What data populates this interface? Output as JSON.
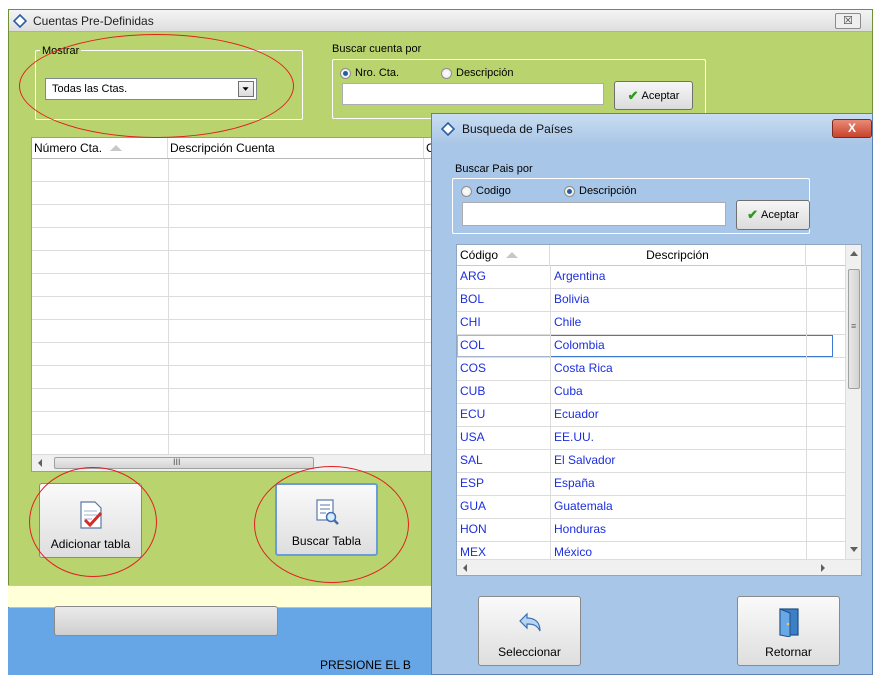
{
  "main_window": {
    "title": "Cuentas Pre-Definidas",
    "close_glyph": "☒",
    "mostrar": {
      "label": "Mostrar",
      "selected": "Todas las Ctas."
    },
    "buscar_cuenta": {
      "label": "Buscar cuenta por",
      "options": [
        "Nro. Cta.",
        "Descripción"
      ],
      "selected_index": 0,
      "value": "",
      "accept_label": "Aceptar"
    },
    "grid": {
      "columns": [
        "Número Cta.",
        "Descripción Cuenta",
        "C"
      ],
      "scroll_glyph": "III"
    },
    "buttons": {
      "adicionar": "Adicionar tabla",
      "buscar": "Buscar Tabla"
    },
    "footer_text": "PRESIONE EL B"
  },
  "dialog": {
    "title": "Busqueda de Países",
    "close_glyph": "X",
    "search": {
      "label": "Buscar Pais por",
      "options": [
        "Codigo",
        "Descripción"
      ],
      "selected_index": 1,
      "value": "",
      "accept_label": "Aceptar"
    },
    "grid": {
      "columns": [
        "Código",
        "Descripción"
      ],
      "selected_row": 3,
      "rows": [
        {
          "code": "ARG",
          "desc": "Argentina"
        },
        {
          "code": "BOL",
          "desc": "Bolivia"
        },
        {
          "code": "CHI",
          "desc": "Chile"
        },
        {
          "code": "COL",
          "desc": "Colombia"
        },
        {
          "code": "COS",
          "desc": "Costa Rica"
        },
        {
          "code": "CUB",
          "desc": "Cuba"
        },
        {
          "code": "ECU",
          "desc": "Ecuador"
        },
        {
          "code": "USA",
          "desc": "EE.UU."
        },
        {
          "code": "SAL",
          "desc": "El Salvador"
        },
        {
          "code": "ESP",
          "desc": "España"
        },
        {
          "code": "GUA",
          "desc": "Guatemala"
        },
        {
          "code": "HON",
          "desc": "Honduras"
        },
        {
          "code": "MEX",
          "desc": "México"
        }
      ]
    },
    "buttons": {
      "seleccionar": "Seleccionar",
      "retornar": "Retornar"
    }
  },
  "colors": {
    "main_bg": "#b9d46e",
    "dialog_bg": "#a8c7e8",
    "grid_text": "#1c2ee0",
    "annotation": "#e0201e"
  }
}
